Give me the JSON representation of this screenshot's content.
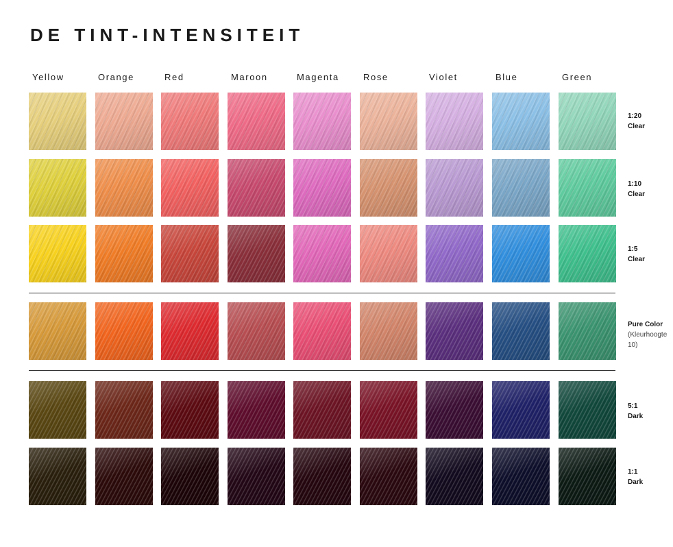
{
  "title": "DE TINT-INTENSITEIT",
  "columns": [
    "Yellow",
    "Orange",
    "Red",
    "Maroon",
    "Magenta",
    "Rose",
    "Violet",
    "Blue",
    "Green"
  ],
  "rows": [
    {
      "line1": "1:20",
      "line2": "Clear",
      "sub": "",
      "colors": [
        "#e6cf7c",
        "#eeaa92",
        "#f07a7a",
        "#ef6b87",
        "#e98fcd",
        "#ecb39b",
        "#d5b0e2",
        "#8cc0e6",
        "#92d6bb"
      ]
    },
    {
      "line1": "1:10",
      "line2": "Clear",
      "sub": "",
      "colors": [
        "#dfd03c",
        "#ef8e4a",
        "#f26160",
        "#c74a6e",
        "#de6bbf",
        "#d69370",
        "#b99ad2",
        "#7ba7c8",
        "#5fcb9e"
      ]
    },
    {
      "line1": "1:5",
      "line2": "Clear",
      "sub": "",
      "colors": [
        "#f8d21e",
        "#f07c26",
        "#c8463b",
        "#8a2f3a",
        "#e268b9",
        "#ee8a80",
        "#9169c9",
        "#318fde",
        "#3fc08d"
      ]
    },
    {
      "line1": "Pure Color",
      "line2": "",
      "sub": "(Kleurhoogte 10)",
      "colors": [
        "#d79a3a",
        "#f2651e",
        "#de2a2f",
        "#b74e52",
        "#ea4f75",
        "#d2856a",
        "#5b2f7e",
        "#254f83",
        "#3b9470"
      ]
    },
    {
      "line1": "5:1",
      "line2": "Dark",
      "sub": "",
      "colors": [
        "#5a4712",
        "#6d2719",
        "#5d0a11",
        "#5f0d2c",
        "#6d1424",
        "#7a1326",
        "#3b0e34",
        "#1f2168",
        "#11483c"
      ]
    },
    {
      "line1": "1:1",
      "line2": "Dark",
      "sub": "",
      "colors": [
        "#2a1f0c",
        "#2c0a0a",
        "#1c0408",
        "#230716",
        "#25060f",
        "#2b0810",
        "#120a1e",
        "#0d0e2a",
        "#0c1a14"
      ]
    }
  ]
}
